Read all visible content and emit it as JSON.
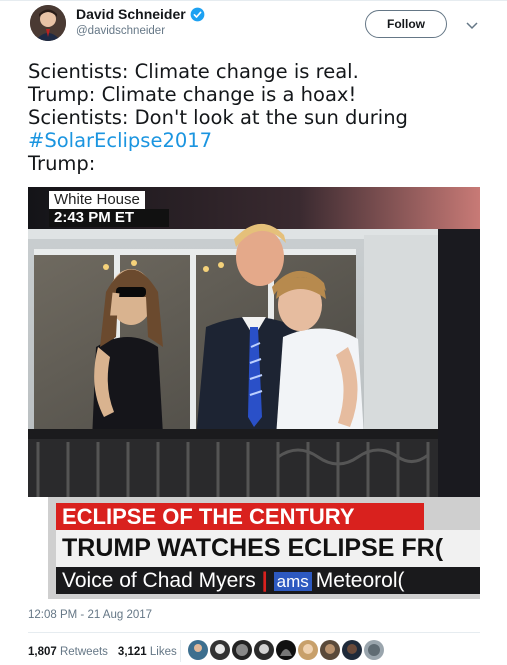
{
  "author": {
    "name": "David Schneider",
    "handle": "@davidschneider",
    "verified": true,
    "follow_label": "Follow"
  },
  "tweet": {
    "lines": [
      "Scientists: Climate change is real.",
      "Trump: Climate change is a hoax!",
      "Scientists: Don't look at the sun during"
    ],
    "hashtag": "#SolarEclipse2017",
    "last_line": "Trump:"
  },
  "media": {
    "location_label": "White House",
    "time_label": "2:43 PM ET",
    "banner_top": "ECLIPSE OF THE CENTURY",
    "banner_headline": "TRUMP WATCHES ECLIPSE FR(",
    "banner_voice": "Voice of Chad Myers",
    "banner_network": "ams",
    "banner_tail": "Meteorol("
  },
  "timestamp": "12:08 PM - 21 Aug 2017",
  "stats": {
    "retweets_count": "1,807",
    "retweets_label": "Retweets",
    "likes_count": "3,121",
    "likes_label": "Likes"
  },
  "colors": {
    "link": "#1b95e0",
    "muted": "#657786",
    "banner_red": "#d9211e"
  },
  "icons": {
    "verified": "verified-badge-icon",
    "caret": "chevron-down-icon"
  }
}
